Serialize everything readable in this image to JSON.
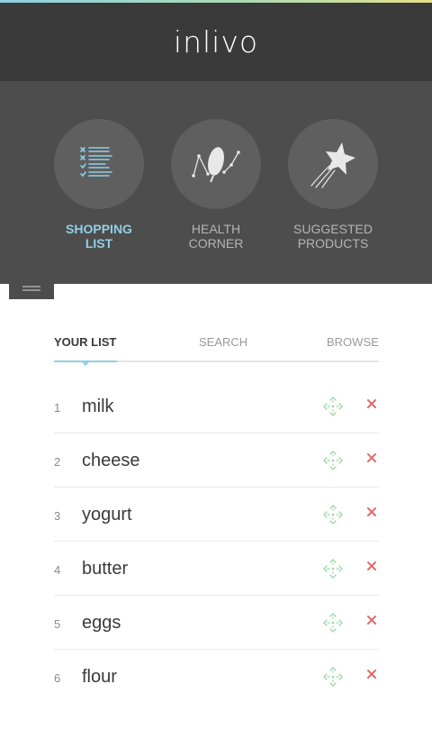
{
  "app": {
    "logo": "inlivo"
  },
  "colors": {
    "header_bg": "#3a3a3a",
    "nav_bg": "#4d4d4d",
    "accent_blue": "#8fd0e6",
    "move_green": "#9ad6a0",
    "delete_red": "#e06b6b"
  },
  "nav": [
    {
      "line1": "SHOPPING",
      "line2": "LIST",
      "icon": "shopping-list-icon",
      "active": true
    },
    {
      "line1": "HEALTH",
      "line2": "CORNER",
      "icon": "health-leaf-icon",
      "active": false
    },
    {
      "line1": "SUGGESTED",
      "line2": "PRODUCTS",
      "icon": "shooting-star-icon",
      "active": false
    }
  ],
  "tabs": {
    "your_list": "YOUR LIST",
    "search": "SEARCH",
    "browse": "BROWSE"
  },
  "list": {
    "items": [
      {
        "num": "1",
        "name": "milk"
      },
      {
        "num": "2",
        "name": "cheese"
      },
      {
        "num": "3",
        "name": "yogurt"
      },
      {
        "num": "4",
        "name": "butter"
      },
      {
        "num": "5",
        "name": "eggs"
      },
      {
        "num": "6",
        "name": "flour"
      }
    ]
  }
}
